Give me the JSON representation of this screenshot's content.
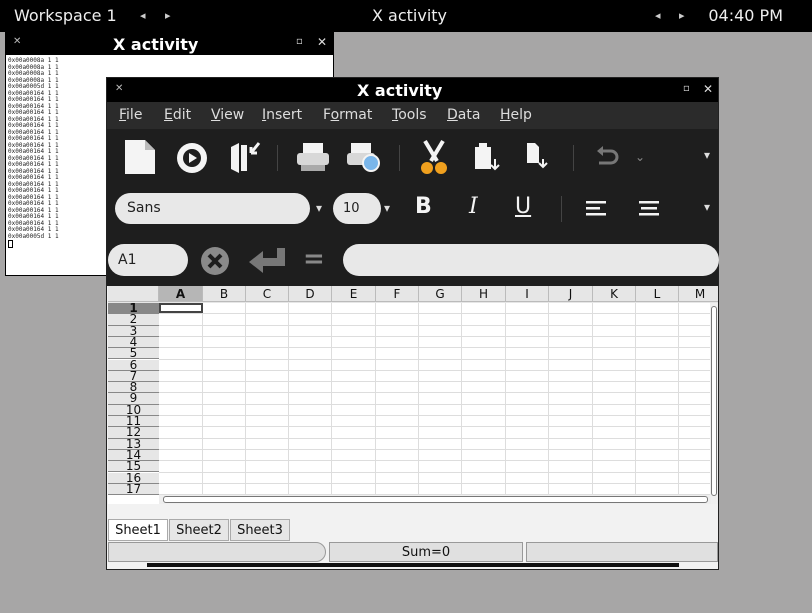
{
  "top_panel": {
    "workspace": "Workspace 1",
    "title": "X activity",
    "clock": "04:40 PM"
  },
  "back_window": {
    "title": "X activity",
    "log_lines": [
      "0x00a0008a 1 1",
      "0x00a0008a 1 1",
      "0x00a0008a 1 1",
      "0x00a0008a 1 1",
      "0x00a0005d 1 1",
      "0x00a00164 1 1",
      "0x00a00164 1 1",
      "0x00a00164 1 1",
      "0x00a00164 1 1",
      "0x00a00164 1 1",
      "0x00a00164 1 1",
      "0x00a00164 1 1",
      "0x00a00164 1 1",
      "0x00a00164 1 1",
      "0x00a00164 1 1",
      "0x00a00164 1 1",
      "0x00a00164 1 1",
      "0x00a00164 1 1",
      "0x00a00164 1 1",
      "0x00a00164 1 1",
      "0x00a00164 1 1",
      "0x00a00164 1 1",
      "0x00a00164 1 1",
      "0x00a00164 1 1",
      "0x00a00164 1 1",
      "0x00a00164 1 1",
      "0x00a00164 1 1",
      "0x00a0005d 1 1"
    ]
  },
  "main_window": {
    "title": "X activity",
    "menu": [
      "File",
      "Edit",
      "View",
      "Insert",
      "Format",
      "Tools",
      "Data",
      "Help"
    ],
    "menu_underline": [
      "F",
      "E",
      "V",
      "I",
      "o",
      "T",
      "D",
      "H"
    ],
    "font_name": "Sans",
    "font_size": "10",
    "toolbar_icons": [
      "new-icon",
      "present-icon",
      "import-icon",
      "print-icon",
      "print-preview-icon",
      "cut-icon",
      "paste-icon",
      "copy-format-icon",
      "undo-icon",
      "overflow-chevron-icon"
    ],
    "format_icons": [
      "bold-icon",
      "italic-icon",
      "underline-icon",
      "align-left-icon",
      "align-center-icon"
    ],
    "format_glyphs": {
      "bold": "B",
      "italic": "I",
      "underline": "U"
    },
    "cell_ref": "A1",
    "formula_equals": "=",
    "formula_value": "",
    "columns": [
      "A",
      "B",
      "C",
      "D",
      "E",
      "F",
      "G",
      "H",
      "I",
      "J",
      "K",
      "L",
      "M"
    ],
    "rows": [
      "1",
      "2",
      "3",
      "4",
      "5",
      "6",
      "7",
      "8",
      "9",
      "10",
      "11",
      "12",
      "13",
      "14",
      "15",
      "16",
      "17"
    ],
    "selected_column": "A",
    "selected_row": "1",
    "sheets": [
      "Sheet1",
      "Sheet2",
      "Sheet3"
    ],
    "active_sheet": "Sheet1",
    "status_sum": "Sum=0"
  }
}
